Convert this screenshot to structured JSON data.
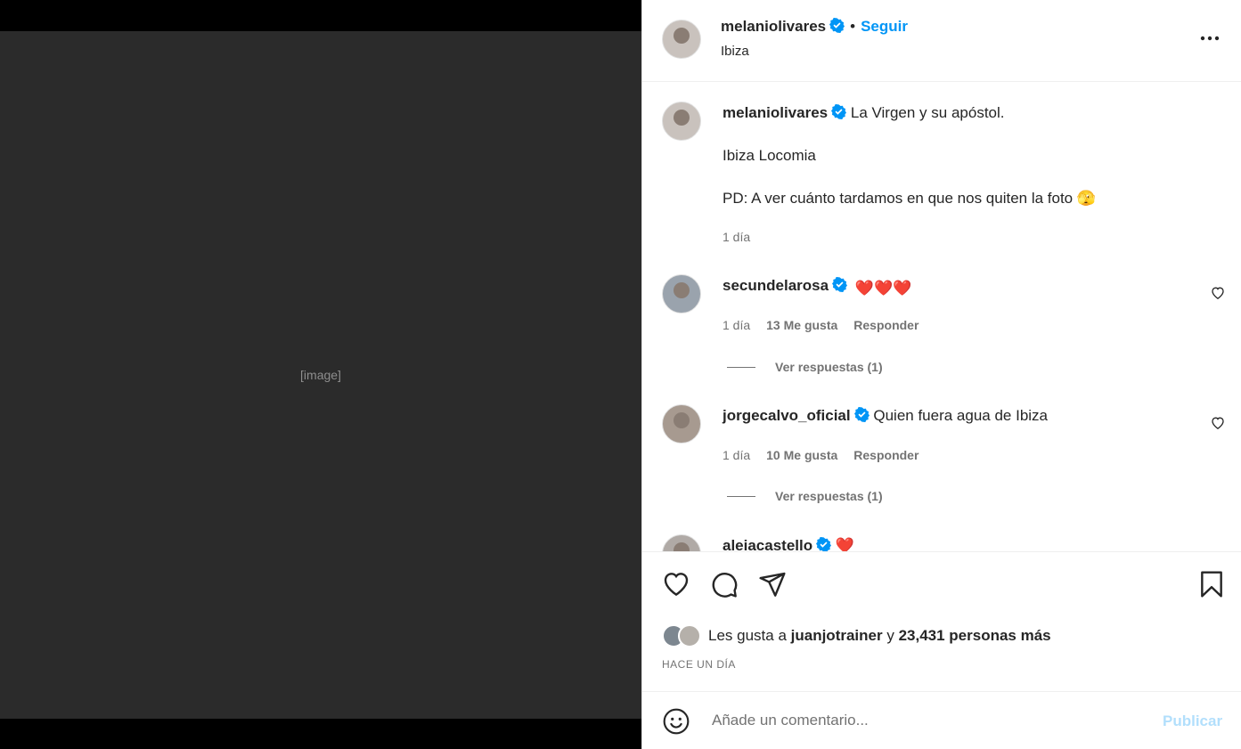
{
  "header": {
    "username": "melaniolivares",
    "separator": "•",
    "follow_label": "Seguir",
    "location": "Ibiza"
  },
  "caption": {
    "username": "melaniolivares",
    "line1": "La Virgen y su apóstol.",
    "line2": "Ibiza Locomia",
    "line3": "PD: A ver cuánto tardamos en que nos quiten la foto 🫣",
    "time": "1 día"
  },
  "comments": [
    {
      "username": "secundelarosa",
      "text": "❤️❤️❤️",
      "time": "1 día",
      "likes": "13 Me gusta",
      "reply_label": "Responder",
      "view_replies": "Ver respuestas (1)"
    },
    {
      "username": "jorgecalvo_oficial",
      "text": "Quien fuera agua de Ibiza",
      "time": "1 día",
      "likes": "10 Me gusta",
      "reply_label": "Responder",
      "view_replies": "Ver respuestas (1)"
    },
    {
      "username": "aleiacastello",
      "text": "❤️"
    }
  ],
  "likes_line": {
    "prefix": "Les gusta a",
    "user": "juanjotrainer",
    "connector": "y",
    "others": "23,431 personas más"
  },
  "timestamp": "HACE UN DÍA",
  "comment_box": {
    "placeholder": "Añade un comentario...",
    "publish_label": "Publicar"
  },
  "colors": {
    "accent": "#0095f6",
    "verified": "#0095f6",
    "publish_disabled": "#b2dffc",
    "heart_red": "#ed4956"
  },
  "icons": [
    "verified-icon",
    "more-options-icon",
    "heart-icon",
    "comment-icon",
    "share-icon",
    "bookmark-icon",
    "emoji-icon"
  ]
}
